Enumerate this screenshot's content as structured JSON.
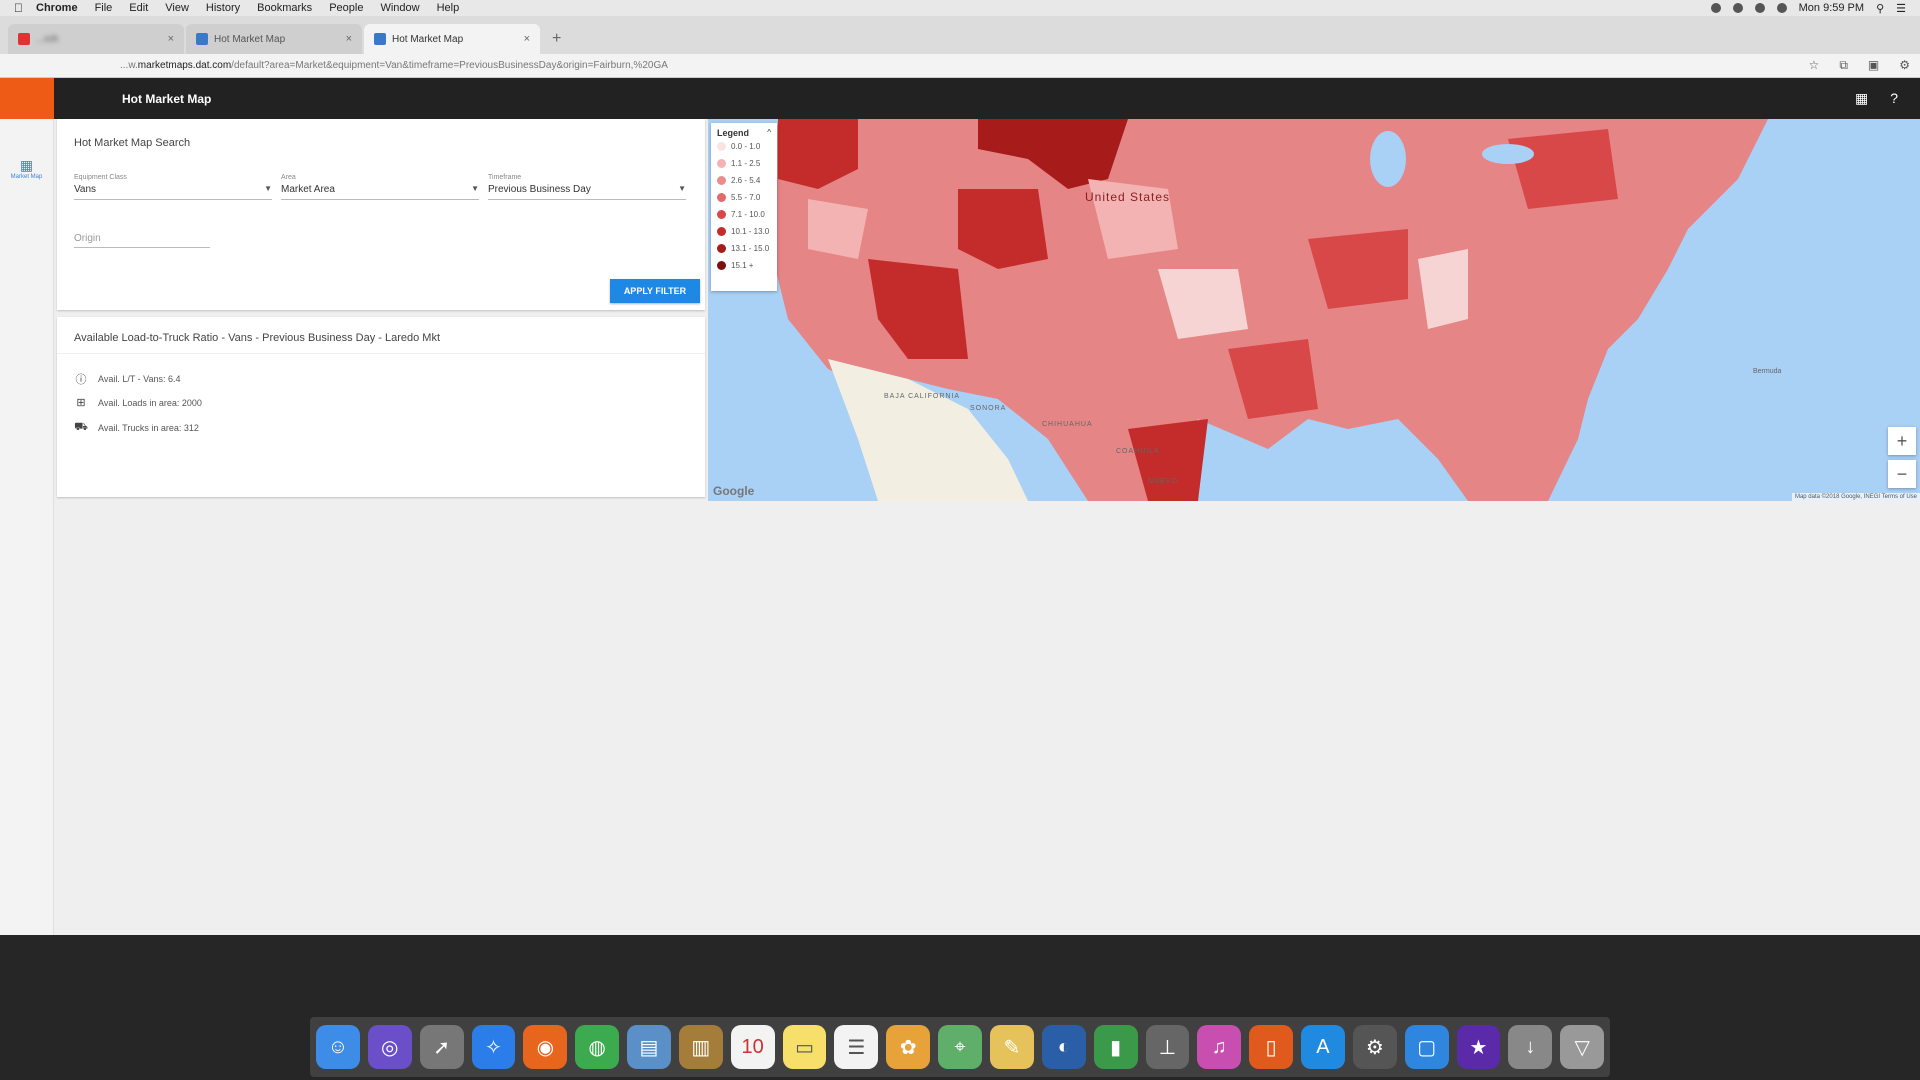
{
  "menubar": {
    "items": [
      "Chrome",
      "File",
      "Edit",
      "View",
      "History",
      "Bookmarks",
      "People",
      "Window",
      "Help"
    ],
    "clock": "Mon 9:59 PM"
  },
  "tabs": [
    {
      "title": "...rch"
    },
    {
      "title": "Hot Market Map"
    },
    {
      "title": "Hot Market Map"
    }
  ],
  "address": {
    "url_prefix": "...w.",
    "url_domain": "marketmaps.dat.com",
    "url_rest": "/default?area=Market&equipment=Van&timeframe=PreviousBusinessDay&origin=Fairburn,%20GA"
  },
  "appbar": {
    "title": "Hot Market Map"
  },
  "sidenav": {
    "item_label": "Market Map"
  },
  "search": {
    "heading": "Hot Market Map Search",
    "equipment": {
      "label": "Equipment Class",
      "value": "Vans"
    },
    "area": {
      "label": "Area",
      "value": "Market Area"
    },
    "timeframe": {
      "label": "Timeframe",
      "value": "Previous Business Day"
    },
    "origin_placeholder": "Origin",
    "apply_label": "APPLY FILTER"
  },
  "ratio": {
    "heading": "Available Load-to-Truck Ratio - Vans - Previous Business Day - Laredo Mkt",
    "stats": [
      {
        "icon": "info-icon",
        "text": "Avail. L/T - Vans: 6.4"
      },
      {
        "icon": "grid-icon",
        "text": "Avail. Loads in area: 2000"
      },
      {
        "icon": "truck-icon",
        "text": "Avail. Trucks in area: 312"
      }
    ]
  },
  "legend": {
    "title": "Legend",
    "entries": [
      {
        "range": "0.0 - 1.0",
        "color": "#fbe3e3"
      },
      {
        "range": "1.1 - 2.5",
        "color": "#f4b3b3"
      },
      {
        "range": "2.6 - 5.4",
        "color": "#ec8c8c"
      },
      {
        "range": "5.5 - 7.0",
        "color": "#e26a6a"
      },
      {
        "range": "7.1 - 10.0",
        "color": "#d94848"
      },
      {
        "range": "10.1 - 13.0",
        "color": "#c42b2b"
      },
      {
        "range": "13.1 - 15.0",
        "color": "#a71b1b"
      },
      {
        "range": "15.1 +",
        "color": "#7d0f0f"
      }
    ]
  },
  "map": {
    "labels": {
      "us": "United States",
      "baja": "BAJA CALIFORNIA",
      "sonora": "SONORA",
      "chihuahua": "CHIHUAHUA",
      "coahuila": "COAHUILA",
      "nuevo": "NUEVO",
      "bermuda": "Bermuda"
    },
    "attribution": "Map data ©2018 Google, INEGI   Terms of Use",
    "logo": "Google"
  },
  "colors": {
    "accent": "#1e88e5",
    "brand": "#ee5b16",
    "appbar": "#222222"
  }
}
